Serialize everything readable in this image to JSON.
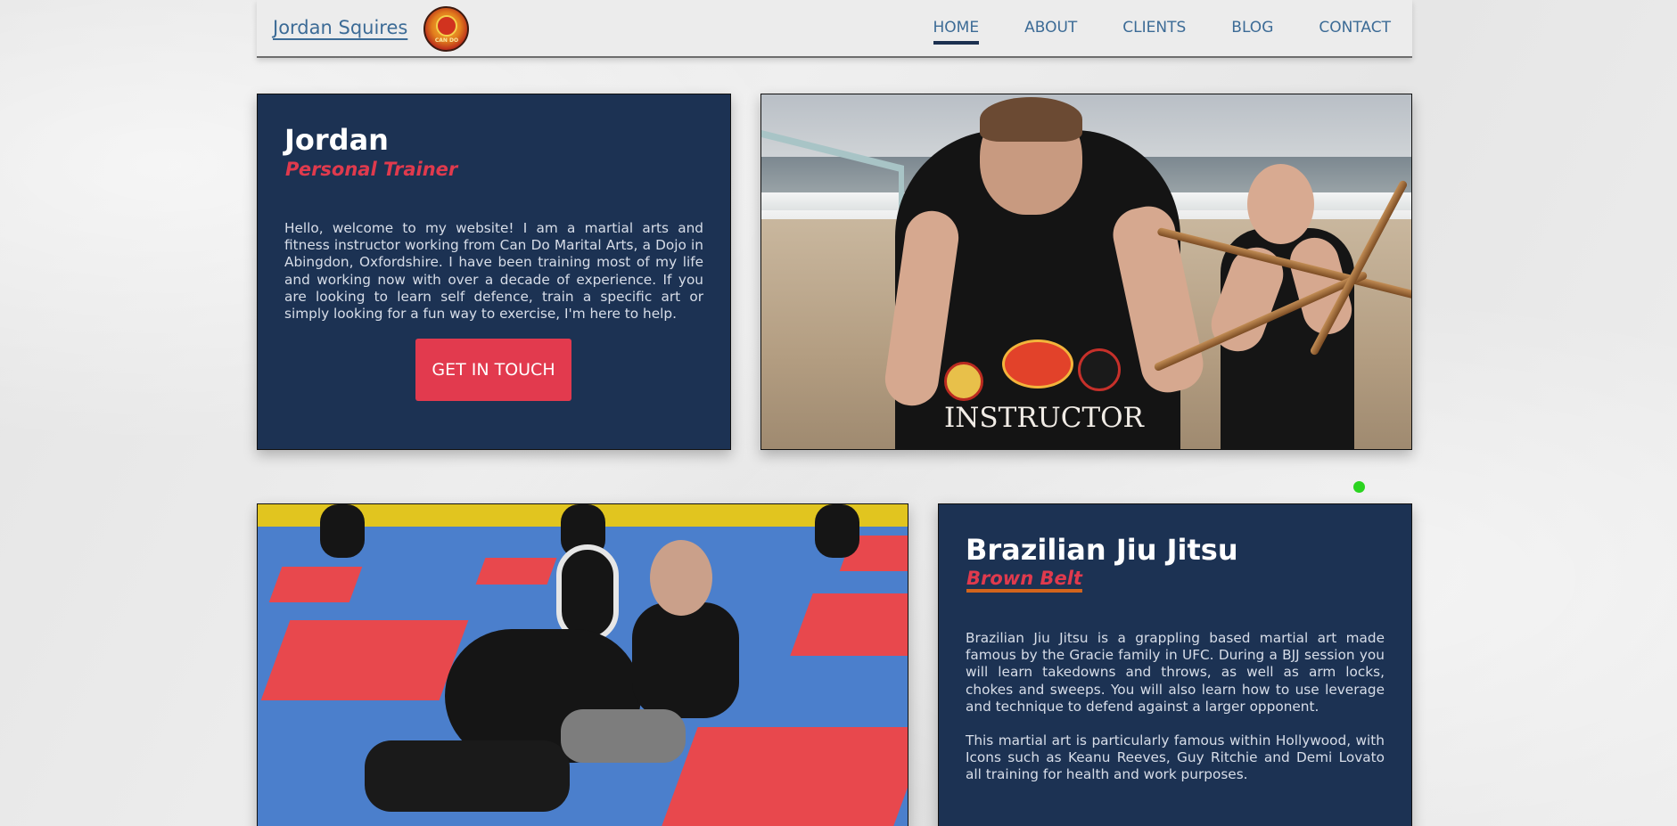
{
  "header": {
    "site_title": "Jordan Squires",
    "logo_text": "CAN DO",
    "nav": [
      {
        "label": "HOME",
        "active": true
      },
      {
        "label": "ABOUT",
        "active": false
      },
      {
        "label": "CLIENTS",
        "active": false
      },
      {
        "label": "BLOG",
        "active": false
      },
      {
        "label": "CONTACT",
        "active": false
      }
    ]
  },
  "intro": {
    "name": "Jordan",
    "role": "Personal Trainer",
    "text": "Hello, welcome to my website! I am a martial arts and fitness instructor working from Can Do Marital Arts, a Dojo in Abingdon, Oxfordshire. I have been training most of my life and working now with over a decade of experience. If you are looking to learn self defence, train a specific art or simply looking for a fun way to exercise, I'm here to help.",
    "cta_label": "GET IN TOUCH"
  },
  "beach_photo": {
    "shirt_text": "INSTRUCTOR"
  },
  "bjj": {
    "title": "Brazilian Jiu Jitsu",
    "belt": "Brown Belt",
    "paragraphs": [
      "Brazilian Jiu Jitsu is a grappling based martial art made famous by the Gracie family in UFC. During a BJJ session you will learn takedowns and throws, as well as arm locks, chokes and sweeps. You will also learn how to use leverage and technique to defend against a larger opponent.",
      "This martial art is particularly famous within Hollywood, with Icons such as Keanu Reeves, Guy Ritchie and Demi Lovato all training for health and work purposes."
    ]
  },
  "colors": {
    "card_bg": "#1c3253",
    "accent_red": "#e23a4e",
    "link_blue": "#3c6b96",
    "online_green": "#2bd420"
  }
}
